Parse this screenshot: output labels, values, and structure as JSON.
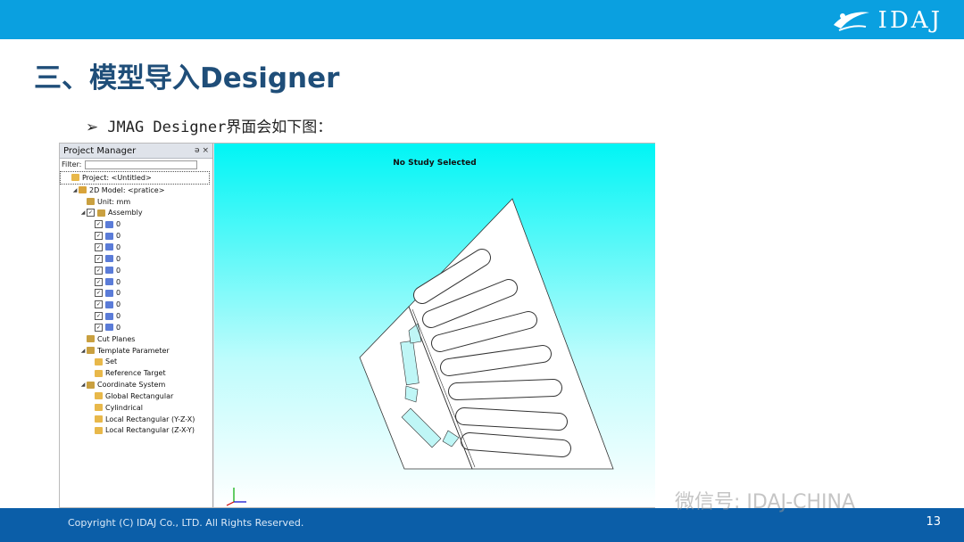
{
  "header": {
    "brand": "IDAJ"
  },
  "slide": {
    "title": "三、模型导入Designer",
    "bullet": "JMAG Designer界面会如下图："
  },
  "project_manager": {
    "title": "Project Manager",
    "controls": "ə ×",
    "filter_label": "Filter:",
    "tree": [
      {
        "label": "Project: <Untitled>",
        "level": 0
      },
      {
        "label": "2D Model: <pratice>",
        "level": 1
      },
      {
        "label": "Unit: mm",
        "level": 2
      },
      {
        "label": "Assembly",
        "level": 2
      },
      {
        "label": "0",
        "level": 3
      },
      {
        "label": "0",
        "level": 3
      },
      {
        "label": "0",
        "level": 3
      },
      {
        "label": "0",
        "level": 3
      },
      {
        "label": "0",
        "level": 3
      },
      {
        "label": "0",
        "level": 3
      },
      {
        "label": "0",
        "level": 3
      },
      {
        "label": "0",
        "level": 3
      },
      {
        "label": "0",
        "level": 3
      },
      {
        "label": "0",
        "level": 3
      },
      {
        "label": "Cut Planes",
        "level": 2
      },
      {
        "label": "Template Parameter",
        "level": 2
      },
      {
        "label": "Set",
        "level": 3
      },
      {
        "label": "Reference Target",
        "level": 3
      },
      {
        "label": "Coordinate System",
        "level": 2
      },
      {
        "label": "Global Rectangular",
        "level": 3
      },
      {
        "label": "Cylindrical",
        "level": 3
      },
      {
        "label": "Local Rectangular (Y-Z-X)",
        "level": 3
      },
      {
        "label": "Local Rectangular (Z-X-Y)",
        "level": 3
      }
    ]
  },
  "viewport": {
    "status": "No Study Selected"
  },
  "footer": {
    "copyright": "Copyright (C) IDAJ Co., LTD. All Rights Reserved.",
    "page": "13",
    "watermark": "微信号: IDAJ-CHINA"
  },
  "colors": {
    "top_bar": "#0aa0e0",
    "footer": "#0b5ea8",
    "title": "#1f4e79",
    "viewport_top": "#00f5f5"
  }
}
